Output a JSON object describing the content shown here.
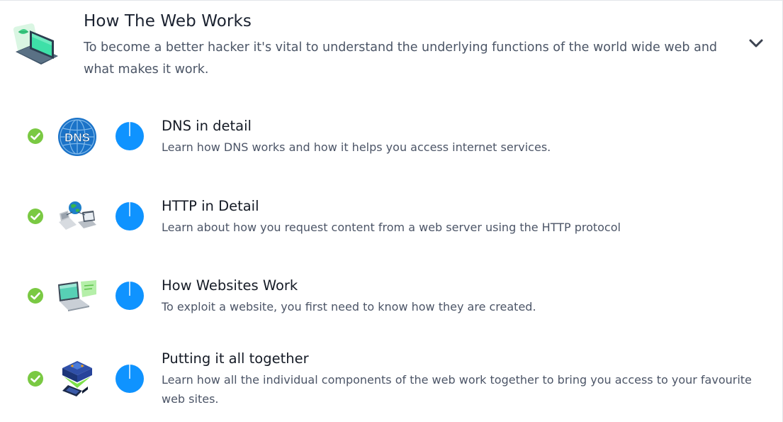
{
  "module": {
    "title": "How The Web Works",
    "description": "To become a better hacker it's vital to understand the underlying functions of the world wide web and what makes it work.",
    "icon": "laptop-illustration-icon",
    "expand_icon": "chevron-down-icon"
  },
  "rooms": [
    {
      "title": "DNS in detail",
      "description": "Learn how DNS works and how it helps you access internet services.",
      "thumbnail": "dns-globe-icon",
      "completed": true,
      "progress": 1.0
    },
    {
      "title": "HTTP in Detail",
      "description": "Learn about how you request content from a web server using the HTTP protocol",
      "thumbnail": "http-network-icon",
      "completed": true,
      "progress": 1.0
    },
    {
      "title": "How Websites Work",
      "description": "To exploit a website, you first need to know how they are created.",
      "thumbnail": "laptop-website-icon",
      "completed": true,
      "progress": 1.0
    },
    {
      "title": "Putting it all together",
      "description": "Learn how all the individual components of the web work together to bring you access to your favourite web sites.",
      "thumbnail": "web-components-cube-icon",
      "completed": true,
      "progress": 1.0
    }
  ],
  "colors": {
    "check_green": "#7ac943",
    "progress_blue": "#0f93ff",
    "text_dark": "#1b2230",
    "text_muted": "#4b5566",
    "dns_blue": "#1b73c8"
  }
}
